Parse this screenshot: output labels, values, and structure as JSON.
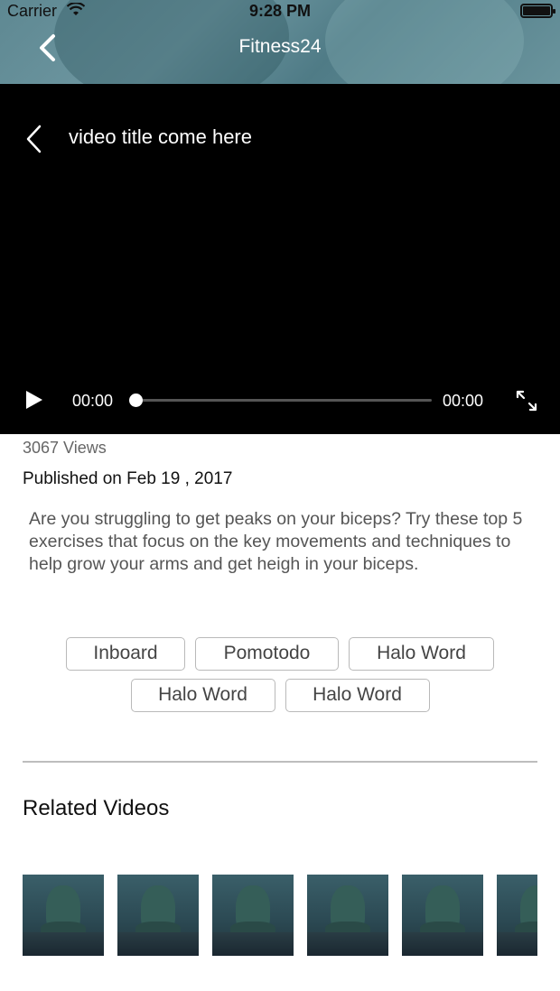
{
  "status_bar": {
    "carrier": "Carrier",
    "time": "9:28 PM"
  },
  "header": {
    "title": "Fitness24"
  },
  "player": {
    "video_title": "video title come here",
    "current_time": "00:00",
    "duration": "00:00",
    "progress": 0
  },
  "video": {
    "views": "3067 Views",
    "published": "Published on Feb 19 , 2017",
    "description": "Are you struggling to get peaks on your biceps? Try these top 5  exercises that focus on the key movements and techniques to help grow your arms and get heigh in your biceps."
  },
  "tags": {
    "row1": [
      "Inboard",
      "Pomotodo",
      "Halo Word"
    ],
    "row2": [
      "Halo Word",
      "Halo Word"
    ]
  },
  "related": {
    "title": "Related Videos",
    "thumbnail_count": 6
  },
  "colors": {
    "header_accent": "#5e8892",
    "player_bg": "#000000",
    "tag_border": "#b9b9b9"
  },
  "icons": [
    "wifi-icon",
    "battery-icon",
    "back-chevron-icon",
    "play-icon",
    "fullscreen-icon"
  ]
}
